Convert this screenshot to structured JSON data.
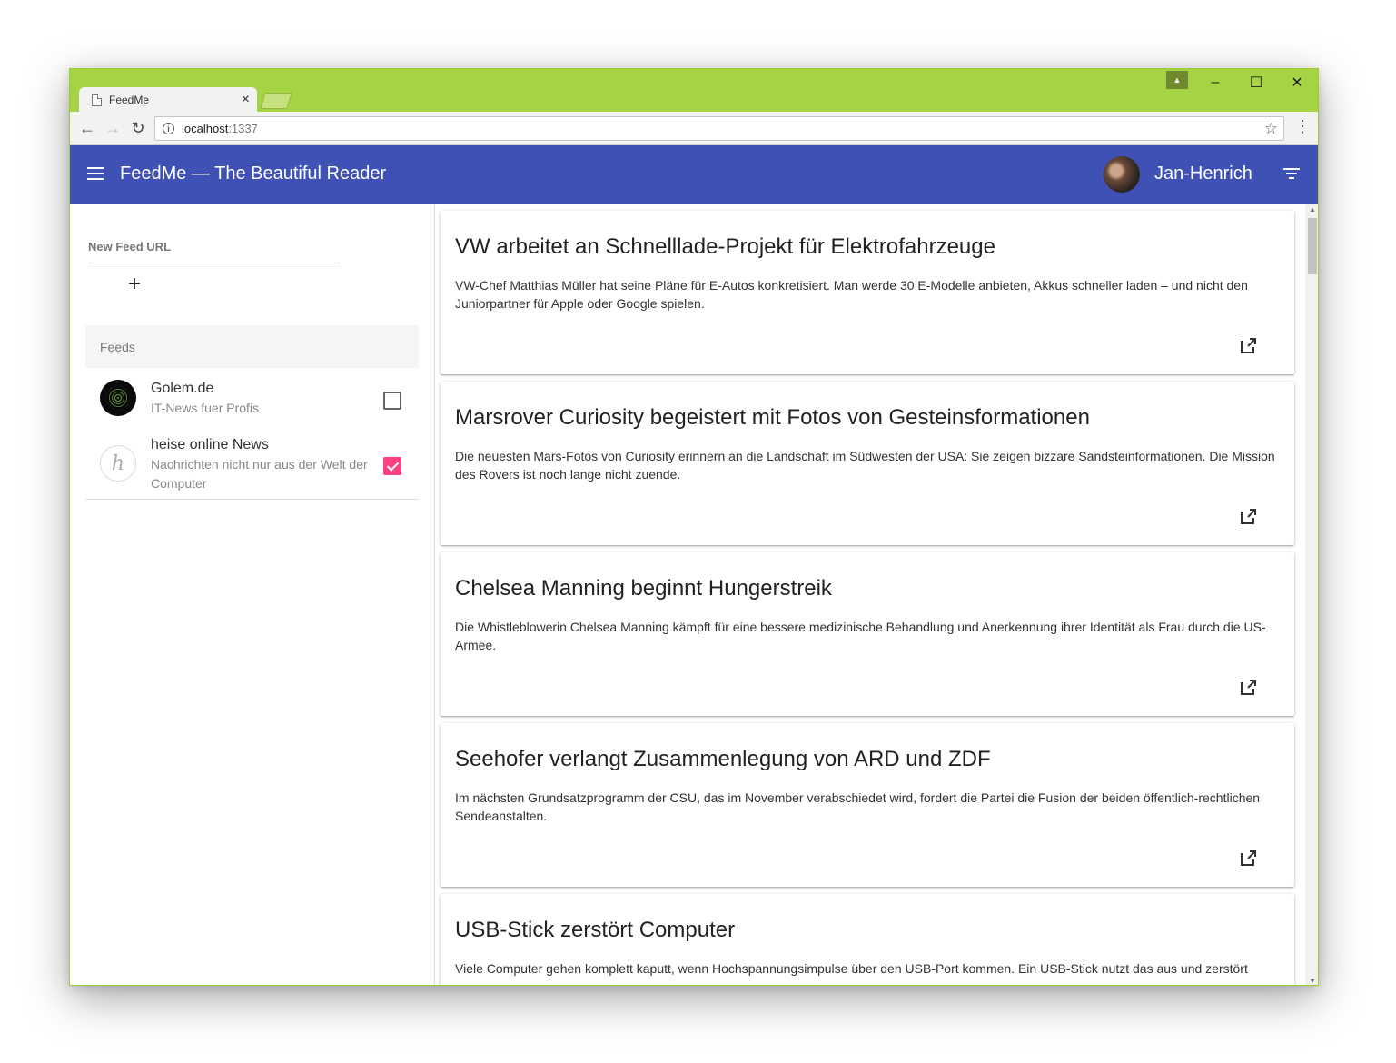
{
  "browser": {
    "tab_title": "FeedMe",
    "url_host": "localhost",
    "url_port": ":1337"
  },
  "app": {
    "title": "FeedMe — The Beautiful Reader",
    "user_name": "Jan-Henrich",
    "colors": {
      "primary": "#3f51b5",
      "accent": "#ff4081",
      "chrome_frame": "#a6d343"
    }
  },
  "sidebar": {
    "new_feed_label": "New Feed URL",
    "add_icon": "+",
    "feeds_header": "Feeds",
    "feeds": [
      {
        "name": "Golem.de",
        "description": "IT-News fuer Profis",
        "checked": false
      },
      {
        "name": "heise online News",
        "description": "Nachrichten nicht nur aus der Welt der Computer",
        "checked": true
      }
    ]
  },
  "articles": [
    {
      "title": "VW arbeitet an Schnelllade-Projekt für Elektrofahrzeuge",
      "summary": "VW-Chef Matthias Müller hat seine Pläne für E-Autos konkretisiert. Man werde 30 E-Modelle anbieten, Akkus schneller laden – und nicht den Juniorpartner für Apple oder Google spielen."
    },
    {
      "title": "Marsrover Curiosity begeistert mit Fotos von Gesteinsformationen",
      "summary": "Die neuesten Mars-Fotos von Curiosity erinnern an die Landschaft im Südwesten der USA: Sie zeigen bizzare Sandsteinformationen. Die Mission des Rovers ist noch lange nicht zuende."
    },
    {
      "title": "Chelsea Manning beginnt Hungerstreik",
      "summary": "Die Whistleblowerin Chelsea Manning kämpft für eine bessere medizinische Behandlung und Anerkennung ihrer Identität als Frau durch die US-Armee."
    },
    {
      "title": "Seehofer verlangt Zusammenlegung von ARD und ZDF",
      "summary": "Im nächsten Grundsatzprogramm der CSU, das im November verabschiedet wird, fordert die Partei die Fusion der beiden öffentlich-rechtlichen Sendeanstalten."
    },
    {
      "title": "USB-Stick zerstört Computer",
      "summary": "Viele Computer gehen komplett kaputt, wenn Hochspannungsimpulse über den USB-Port kommen. Ein USB-Stick nutzt das aus und zerstört"
    }
  ]
}
